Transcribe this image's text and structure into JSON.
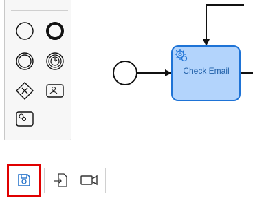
{
  "palette": {
    "top_text": "",
    "tools": [
      "start-event",
      "end-event",
      "intermediate-event",
      "timer-event",
      "gateway",
      "user-task",
      "service-task"
    ]
  },
  "diagram": {
    "task_label": "Check Email"
  },
  "toolbar": {
    "buttons": [
      "save",
      "export",
      "video"
    ]
  },
  "colors": {
    "task_fill": "#b3d4fc",
    "task_stroke": "#1e73d6",
    "highlight": "#e00000",
    "icon_blue": "#1e6ec8"
  }
}
